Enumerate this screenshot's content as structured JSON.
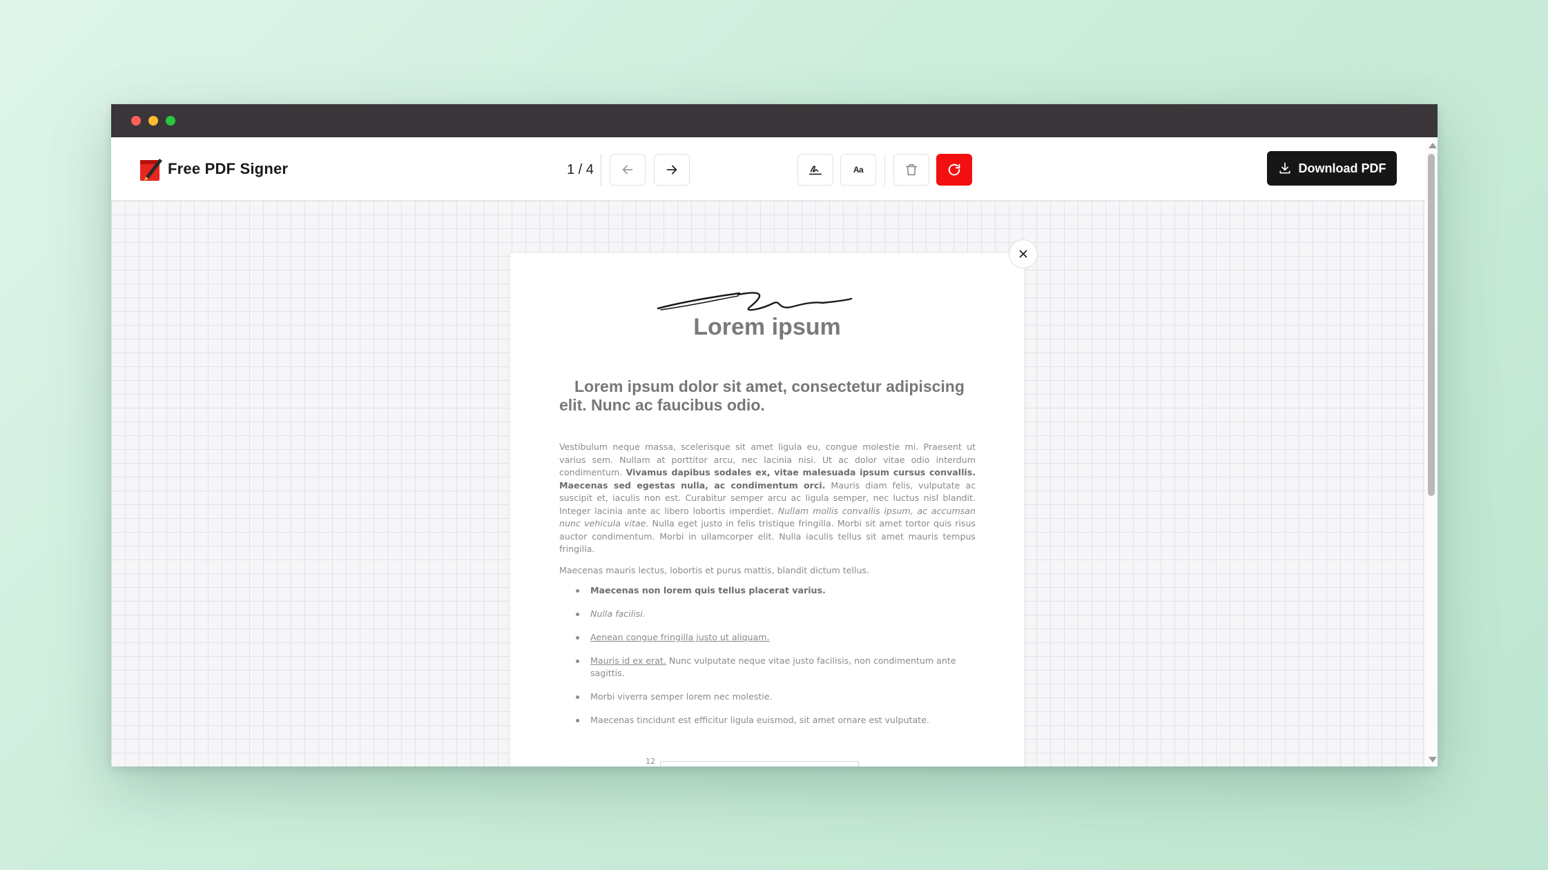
{
  "app": {
    "name": "Free PDF Signer"
  },
  "pager": {
    "current_of_total": "1 / 4"
  },
  "toolbar": {
    "download_label": "Download PDF",
    "text_tool_label": "Aa"
  },
  "colors": {
    "accent_red": "#f20f0f",
    "download_bg": "#161616",
    "titlebar": "#393539"
  },
  "icons": {
    "prev": "arrow-left-icon",
    "next": "arrow-right-icon",
    "signature": "signature-icon",
    "text": "text-icon",
    "delete": "trash-icon",
    "reset": "refresh-icon",
    "download": "download-icon",
    "close": "close-icon"
  },
  "document": {
    "title": "Lorem ipsum",
    "heading": "Lorem ipsum dolor sit amet, consectetur adipiscing elit. Nunc ac faucibus odio.",
    "para1": {
      "part1": "Vestibulum neque massa, scelerisque sit amet ligula eu, congue molestie mi. Praesent ut varius sem. Nullam at porttitor arcu, nec lacinia nisi. Ut ac dolor vitae odio interdum condimentum.",
      "bold": "Vivamus dapibus sodales ex, vitae malesuada ipsum cursus convallis. Maecenas sed egestas nulla, ac condimentum orci.",
      "part2": "Mauris diam felis, vulputate ac suscipit et, iaculis non est. Curabitur semper arcu ac ligula semper, nec luctus nisl blandit. Integer lacinia ante ac libero lobortis imperdiet.",
      "italic": "Nullam mollis convallis ipsum, ac accumsan nunc vehicula vitae.",
      "part3": "Nulla eget justo in felis tristique fringilla. Morbi sit amet tortor quis risus auctor condimentum. Morbi in ullamcorper elit. Nulla iaculis tellus sit amet mauris tempus fringilla."
    },
    "para2": "Maecenas mauris lectus, lobortis et purus mattis, blandit dictum tellus.",
    "list": {
      "item1": "Maecenas non lorem quis tellus placerat varius.",
      "item2": "Nulla facilisi.",
      "item3": "Aenean congue fringilla justo ut aliquam.",
      "item4_link": "Mauris id ex erat.",
      "item4_rest": " Nunc vulputate neque vitae justo facilisis, non condimentum ante sagittis.",
      "item5": "Morbi viverra semper lorem nec molestie.",
      "item6": "Maecenas tincidunt est efficitur ligula euismod, sit amet ornare est vulputate."
    },
    "chart_tick": "12"
  }
}
